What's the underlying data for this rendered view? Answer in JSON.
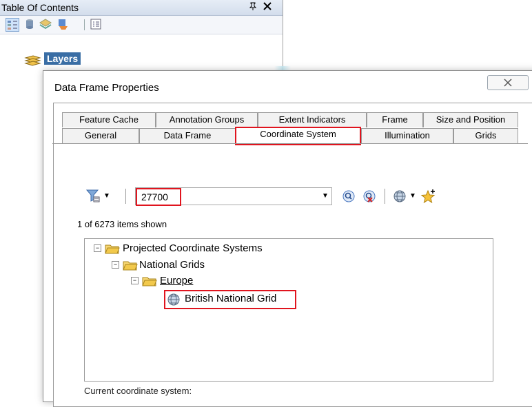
{
  "toc": {
    "title": "Table Of Contents",
    "layers_label": "Layers"
  },
  "dialog": {
    "title": "Data Frame Properties",
    "close_glyph": "✕",
    "tabs_row1": [
      "Feature Cache",
      "Annotation Groups",
      "Extent Indicators",
      "Frame",
      "Size and Position"
    ],
    "tabs_row2": [
      "General",
      "Data Frame",
      "Coordinate System",
      "Illumination",
      "Grids"
    ],
    "selected_tab": "Coordinate System",
    "search_value": "27700",
    "items_shown": "1 of 6273 items shown",
    "tree": [
      {
        "label": "Projected Coordinate Systems",
        "depth": 0,
        "type": "folder"
      },
      {
        "label": "National Grids",
        "depth": 1,
        "type": "folder"
      },
      {
        "label": "Europe",
        "depth": 2,
        "type": "folder"
      },
      {
        "label": "British National Grid",
        "depth": 3,
        "type": "coordinate-system"
      }
    ],
    "current_label": "Current coordinate system:"
  },
  "colors": {
    "highlight": "#e0141e",
    "selection": "#3a6ea5",
    "folder": "#f2c94c"
  },
  "icons": [
    "pin-icon",
    "close-icon",
    "list-by-drawing-order-icon",
    "list-by-source-icon",
    "list-by-visibility-icon",
    "list-by-selection-icon",
    "options-icon",
    "layers-icon",
    "filter-icon",
    "search-icon",
    "clear-search-icon",
    "globe-icon",
    "add-favorite-icon",
    "folder-icon"
  ]
}
